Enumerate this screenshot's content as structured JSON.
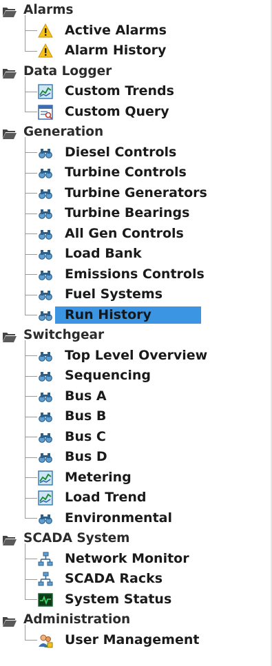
{
  "tree": [
    {
      "type": "group",
      "label": "Alarms",
      "icon": "folder-icon",
      "children": [
        {
          "label": "Active Alarms",
          "icon": "warning-icon"
        },
        {
          "label": "Alarm History",
          "icon": "warning-icon"
        }
      ]
    },
    {
      "type": "group",
      "label": "Data Logger",
      "icon": "folder-icon",
      "children": [
        {
          "label": "Custom Trends",
          "icon": "trend-chart-icon"
        },
        {
          "label": "Custom Query",
          "icon": "query-window-icon"
        }
      ]
    },
    {
      "type": "group",
      "label": "Generation",
      "icon": "folder-icon",
      "children": [
        {
          "label": "Diesel Controls",
          "icon": "binoculars-icon"
        },
        {
          "label": "Turbine Controls",
          "icon": "binoculars-icon"
        },
        {
          "label": "Turbine Generators",
          "icon": "binoculars-icon"
        },
        {
          "label": "Turbine Bearings",
          "icon": "binoculars-icon"
        },
        {
          "label": "All Gen Controls",
          "icon": "binoculars-icon"
        },
        {
          "label": "Load Bank",
          "icon": "binoculars-icon"
        },
        {
          "label": "Emissions Controls",
          "icon": "binoculars-icon"
        },
        {
          "label": "Fuel Systems",
          "icon": "binoculars-icon"
        },
        {
          "label": "Run History",
          "icon": "binoculars-icon",
          "selected": true
        }
      ]
    },
    {
      "type": "group",
      "label": "Switchgear",
      "icon": "folder-icon",
      "children": [
        {
          "label": "Top Level Overview",
          "icon": "binoculars-icon"
        },
        {
          "label": "Sequencing",
          "icon": "binoculars-icon"
        },
        {
          "label": "Bus A",
          "icon": "binoculars-icon"
        },
        {
          "label": "Bus B",
          "icon": "binoculars-icon"
        },
        {
          "label": "Bus C",
          "icon": "binoculars-icon"
        },
        {
          "label": "Bus D",
          "icon": "binoculars-icon"
        },
        {
          "label": "Metering",
          "icon": "trend-chart-icon"
        },
        {
          "label": "Load Trend",
          "icon": "trend-chart-icon"
        },
        {
          "label": "Environmental",
          "icon": "binoculars-icon"
        }
      ]
    },
    {
      "type": "group",
      "label": "SCADA System",
      "icon": "folder-icon",
      "children": [
        {
          "label": "Network Monitor",
          "icon": "network-icon"
        },
        {
          "label": "SCADA Racks",
          "icon": "network-icon"
        },
        {
          "label": "System Status",
          "icon": "status-monitor-icon"
        }
      ]
    },
    {
      "type": "group",
      "label": "Administration",
      "icon": "folder-icon",
      "children": [
        {
          "label": "User Management",
          "icon": "users-icon"
        }
      ]
    }
  ],
  "colors": {
    "selection": "#3c95e2",
    "folder": "#555555"
  }
}
